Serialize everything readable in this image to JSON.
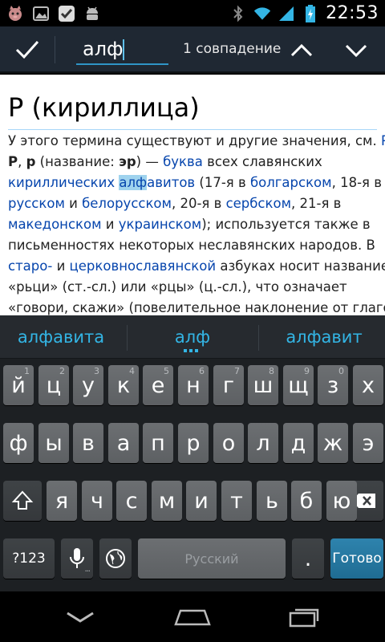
{
  "status_bar": {
    "time": "22:53",
    "left_icons": [
      "cat-app-icon",
      "image-icon",
      "check-app-icon",
      "android-icon"
    ],
    "right_icons": [
      "bluetooth-icon",
      "wifi-icon",
      "signal-icon",
      "battery-charging-icon"
    ]
  },
  "find_bar": {
    "query": "алф",
    "match_count": "1 совпадение"
  },
  "article": {
    "title": "Р (кириллица)",
    "lines": [
      [
        {
          "t": "У этого термина существуют и другие значения, см. "
        },
        {
          "t": "Р.",
          "link": true
        }
      ],
      [
        {
          "t": "Р",
          "bold": true
        },
        {
          "t": ", "
        },
        {
          "t": "р",
          "bold": true
        },
        {
          "t": " (название: "
        },
        {
          "t": "эр",
          "bold": true
        },
        {
          "t": ") — "
        },
        {
          "t": "буква",
          "link": true
        },
        {
          "t": " всех славянских"
        }
      ],
      [
        {
          "t": "кириллических",
          "link": true
        },
        {
          "t": " "
        },
        {
          "t": "алф",
          "link": true,
          "hl": true
        },
        {
          "t": "авитов",
          "link": true
        },
        {
          "t": " (17-я в "
        },
        {
          "t": "болгарском",
          "link": true
        },
        {
          "t": ", 18-я в"
        }
      ],
      [
        {
          "t": "русском",
          "link": true
        },
        {
          "t": " и "
        },
        {
          "t": "белорусском",
          "link": true
        },
        {
          "t": ", 20-я в "
        },
        {
          "t": "сербском",
          "link": true
        },
        {
          "t": ", 21-я в"
        }
      ],
      [
        {
          "t": "македонском",
          "link": true
        },
        {
          "t": " и "
        },
        {
          "t": "украинском",
          "link": true
        },
        {
          "t": "); используется также в"
        }
      ],
      [
        {
          "t": "письменностях некоторых неславянских народов. В"
        }
      ],
      [
        {
          "t": "старо-",
          "link": true
        },
        {
          "t": " и "
        },
        {
          "t": "церковнославянской",
          "link": true
        },
        {
          "t": " азбуках носит название"
        }
      ],
      [
        {
          "t": "«рьци» (ст.-сл.) или «рцы» (ц.-сл.), что означает"
        }
      ],
      [
        {
          "t": "«говори, скажи» (повелительное наклонение от глагола"
        }
      ]
    ]
  },
  "suggestions": [
    "алфавита",
    "алф",
    "алфавит"
  ],
  "keyboard": {
    "row1": [
      {
        "k": "й",
        "n": "1"
      },
      {
        "k": "ц",
        "n": "2"
      },
      {
        "k": "у",
        "n": "3"
      },
      {
        "k": "к",
        "n": "4"
      },
      {
        "k": "е",
        "n": "5"
      },
      {
        "k": "н",
        "n": "6"
      },
      {
        "k": "г",
        "n": "7"
      },
      {
        "k": "ш",
        "n": "8"
      },
      {
        "k": "щ",
        "n": "9"
      },
      {
        "k": "з",
        "n": "0"
      },
      {
        "k": "х",
        "n": ""
      }
    ],
    "row2": [
      "ф",
      "ы",
      "в",
      "а",
      "п",
      "р",
      "о",
      "л",
      "д",
      "ж",
      "э"
    ],
    "row3": [
      "я",
      "ч",
      "с",
      "м",
      "и",
      "т",
      "ь",
      "б",
      "ю"
    ],
    "symbols_label": "?123",
    "space_label": "Русский",
    "period_label": ".",
    "done_label": "Готово"
  },
  "colors": {
    "accent": "#33b5e5",
    "link": "#0645ad",
    "highlight": "#9fd3ee",
    "action_bar": "#1f2833"
  }
}
